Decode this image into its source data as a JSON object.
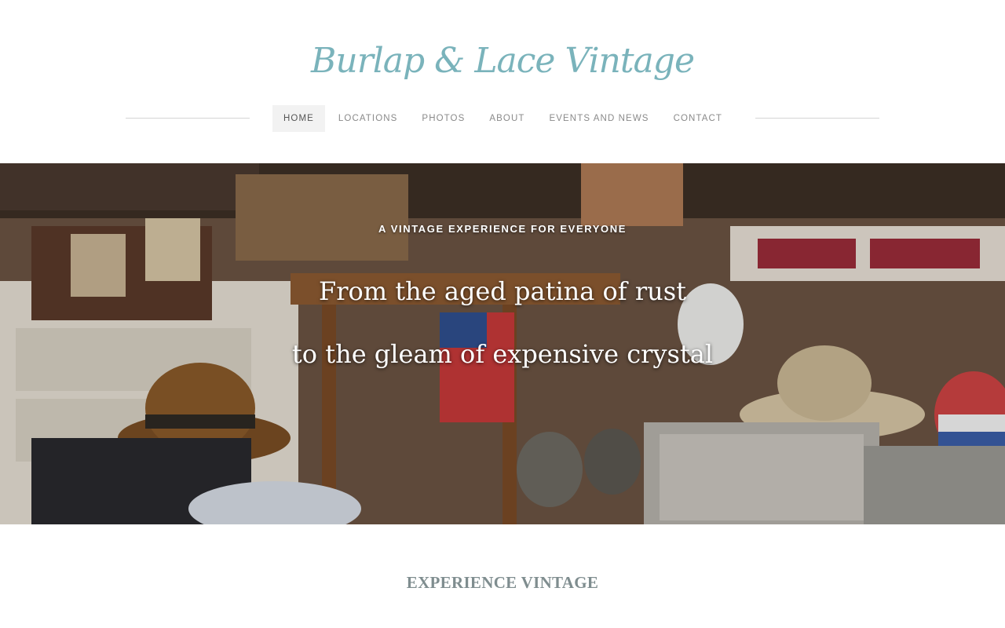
{
  "site": {
    "logo_text": "Burlap & Lace Vintage",
    "accent_color": "#7ab3bb"
  },
  "nav": {
    "items": [
      {
        "label": "HOME",
        "active": true
      },
      {
        "label": "LOCATIONS",
        "active": false
      },
      {
        "label": "PHOTOS",
        "active": false
      },
      {
        "label": "ABOUT",
        "active": false
      },
      {
        "label": "EVENTS AND NEWS",
        "active": false
      },
      {
        "label": "CONTACT",
        "active": false
      }
    ]
  },
  "hero": {
    "kicker": "A VINTAGE EXPERIENCE FOR EVERYONE",
    "line1": "From the aged patina of rust",
    "line2": "to the gleam of expensive crystal"
  },
  "section": {
    "title": "EXPERIENCE VINTAGE"
  }
}
